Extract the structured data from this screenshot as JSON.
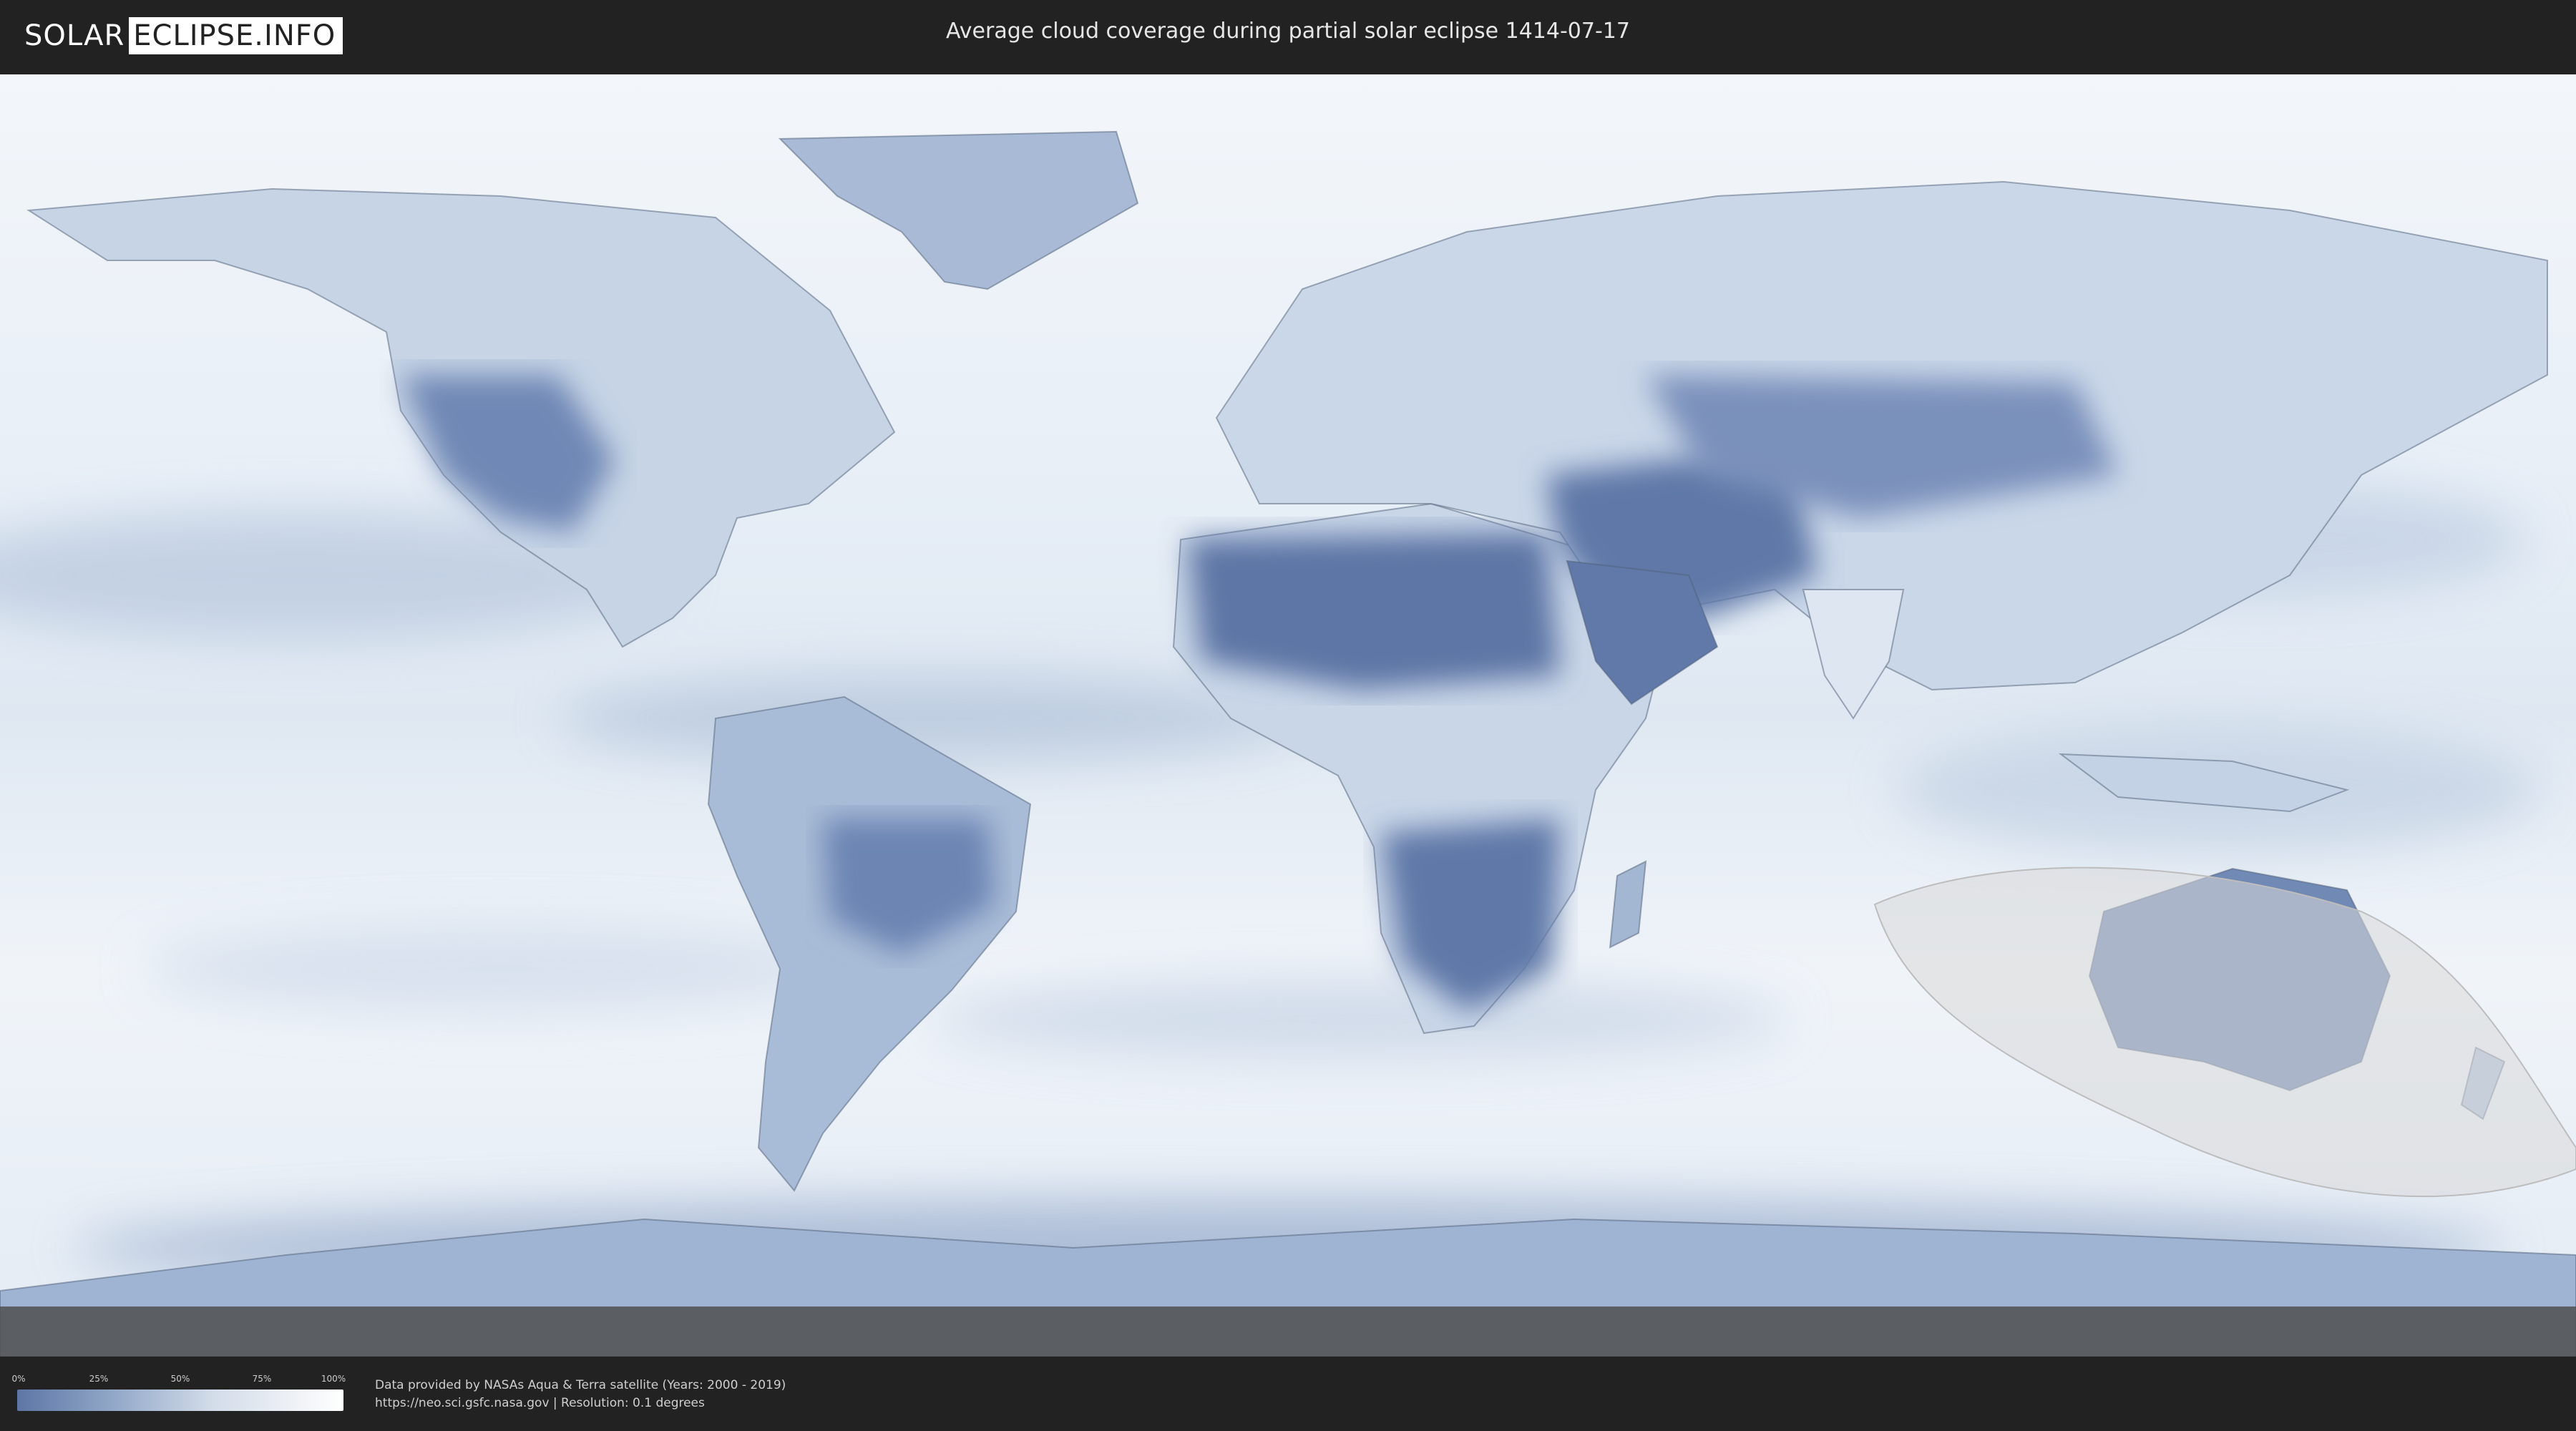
{
  "header": {
    "logo_left": "SOLAR",
    "logo_right": "ECLIPSE.INFO",
    "title": "Average cloud coverage during partial solar eclipse 1414-07-17"
  },
  "map": {
    "type": "world cloud coverage map",
    "projection": "equirectangular",
    "eclipse_shadow": "partial eclipse visibility region over Australia / Southern Ocean"
  },
  "legend": {
    "ticks": [
      "0%",
      "25%",
      "50%",
      "75%",
      "100%"
    ],
    "colors": {
      "low": "#5d76a5",
      "mid": "#a9bbd4",
      "high": "#ffffff"
    }
  },
  "footer": {
    "credit_line_1": "Data provided by NASAs Aqua & Terra satellite (Years: 2000 - 2019)",
    "credit_line_2": "https://neo.sci.gsfc.nasa.gov | Resolution: 0.1 degrees"
  },
  "colors": {
    "header_bg": "#222222",
    "ocean_cloud": "#e9f0f7",
    "clear_land": "#6a84b3",
    "eclipse_overlay": "#d9d9d9"
  }
}
